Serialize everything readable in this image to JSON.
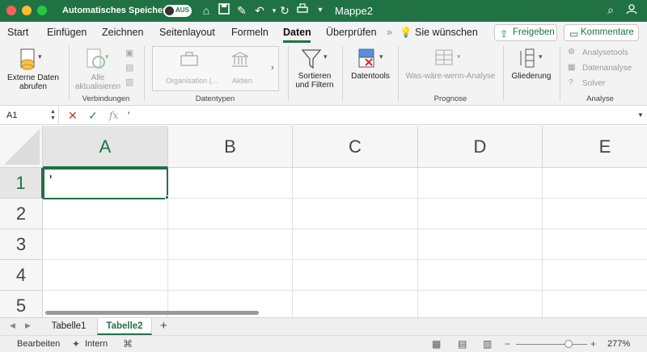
{
  "titlebar": {
    "autosave_label": "Automatisches Speichern",
    "autosave_state": "AUS",
    "document_title": "Mappe2",
    "background_color": "#207245"
  },
  "tabs": [
    {
      "label": "Start"
    },
    {
      "label": "Einfügen"
    },
    {
      "label": "Zeichnen"
    },
    {
      "label": "Seitenlayout"
    },
    {
      "label": "Formeln"
    },
    {
      "label": "Daten"
    },
    {
      "label": "Überprüfen"
    }
  ],
  "active_tab": "Daten",
  "tell_me": "Sie wünschen",
  "share_button": "Freigeben",
  "comment_button": "Kommentare",
  "ribbon": {
    "get_data": {
      "line1": "Externe Daten",
      "line2": "abrufen"
    },
    "refresh_all": {
      "line1": "Alle",
      "line2": "aktualisieren"
    },
    "group_connections": "Verbindungen",
    "datatype_org": "Organisation (...",
    "datatype_stocks": "Aktien",
    "group_datatypes": "Datentypen",
    "sort_filter": {
      "line1": "Sortieren",
      "line2": "und Filtern"
    },
    "datatools": "Datentools",
    "whatif": "Was-wäre-wenn-Analyse",
    "group_forecast": "Prognose",
    "outline": "Gliederung",
    "analysis_tools": "Analysetools",
    "data_analysis": "Datenanalyse",
    "solver": "Solver",
    "group_analysis": "Analyse"
  },
  "formula_bar": {
    "name_box": "A1",
    "fx": "fx",
    "content": "'"
  },
  "grid": {
    "columns": [
      "A",
      "B",
      "C",
      "D",
      "E"
    ],
    "rows": [
      "1",
      "2",
      "3",
      "4",
      "5"
    ],
    "active_cell": "A1",
    "active_cell_value": "'"
  },
  "sheets": [
    {
      "label": "Tabelle1"
    },
    {
      "label": "Tabelle2"
    }
  ],
  "active_sheet": "Tabelle2",
  "statusbar": {
    "mode": "Bearbeiten",
    "accessibility": "Intern",
    "zoom": "277%"
  }
}
